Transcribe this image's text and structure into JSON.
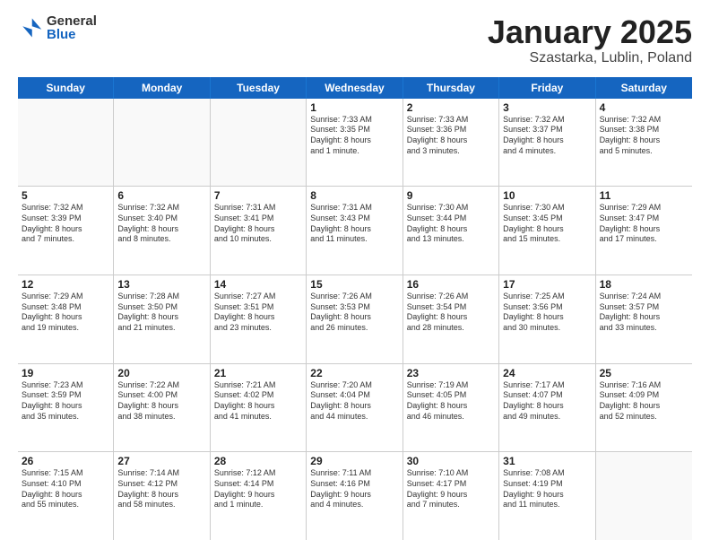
{
  "logo": {
    "general": "General",
    "blue": "Blue"
  },
  "header": {
    "month": "January 2025",
    "location": "Szastarka, Lublin, Poland"
  },
  "weekdays": [
    "Sunday",
    "Monday",
    "Tuesday",
    "Wednesday",
    "Thursday",
    "Friday",
    "Saturday"
  ],
  "rows": [
    [
      {
        "day": "",
        "text": "",
        "empty": true
      },
      {
        "day": "",
        "text": "",
        "empty": true
      },
      {
        "day": "",
        "text": "",
        "empty": true
      },
      {
        "day": "1",
        "text": "Sunrise: 7:33 AM\nSunset: 3:35 PM\nDaylight: 8 hours\nand 1 minute."
      },
      {
        "day": "2",
        "text": "Sunrise: 7:33 AM\nSunset: 3:36 PM\nDaylight: 8 hours\nand 3 minutes."
      },
      {
        "day": "3",
        "text": "Sunrise: 7:32 AM\nSunset: 3:37 PM\nDaylight: 8 hours\nand 4 minutes."
      },
      {
        "day": "4",
        "text": "Sunrise: 7:32 AM\nSunset: 3:38 PM\nDaylight: 8 hours\nand 5 minutes."
      }
    ],
    [
      {
        "day": "5",
        "text": "Sunrise: 7:32 AM\nSunset: 3:39 PM\nDaylight: 8 hours\nand 7 minutes."
      },
      {
        "day": "6",
        "text": "Sunrise: 7:32 AM\nSunset: 3:40 PM\nDaylight: 8 hours\nand 8 minutes."
      },
      {
        "day": "7",
        "text": "Sunrise: 7:31 AM\nSunset: 3:41 PM\nDaylight: 8 hours\nand 10 minutes."
      },
      {
        "day": "8",
        "text": "Sunrise: 7:31 AM\nSunset: 3:43 PM\nDaylight: 8 hours\nand 11 minutes."
      },
      {
        "day": "9",
        "text": "Sunrise: 7:30 AM\nSunset: 3:44 PM\nDaylight: 8 hours\nand 13 minutes."
      },
      {
        "day": "10",
        "text": "Sunrise: 7:30 AM\nSunset: 3:45 PM\nDaylight: 8 hours\nand 15 minutes."
      },
      {
        "day": "11",
        "text": "Sunrise: 7:29 AM\nSunset: 3:47 PM\nDaylight: 8 hours\nand 17 minutes."
      }
    ],
    [
      {
        "day": "12",
        "text": "Sunrise: 7:29 AM\nSunset: 3:48 PM\nDaylight: 8 hours\nand 19 minutes."
      },
      {
        "day": "13",
        "text": "Sunrise: 7:28 AM\nSunset: 3:50 PM\nDaylight: 8 hours\nand 21 minutes."
      },
      {
        "day": "14",
        "text": "Sunrise: 7:27 AM\nSunset: 3:51 PM\nDaylight: 8 hours\nand 23 minutes."
      },
      {
        "day": "15",
        "text": "Sunrise: 7:26 AM\nSunset: 3:53 PM\nDaylight: 8 hours\nand 26 minutes."
      },
      {
        "day": "16",
        "text": "Sunrise: 7:26 AM\nSunset: 3:54 PM\nDaylight: 8 hours\nand 28 minutes."
      },
      {
        "day": "17",
        "text": "Sunrise: 7:25 AM\nSunset: 3:56 PM\nDaylight: 8 hours\nand 30 minutes."
      },
      {
        "day": "18",
        "text": "Sunrise: 7:24 AM\nSunset: 3:57 PM\nDaylight: 8 hours\nand 33 minutes."
      }
    ],
    [
      {
        "day": "19",
        "text": "Sunrise: 7:23 AM\nSunset: 3:59 PM\nDaylight: 8 hours\nand 35 minutes."
      },
      {
        "day": "20",
        "text": "Sunrise: 7:22 AM\nSunset: 4:00 PM\nDaylight: 8 hours\nand 38 minutes."
      },
      {
        "day": "21",
        "text": "Sunrise: 7:21 AM\nSunset: 4:02 PM\nDaylight: 8 hours\nand 41 minutes."
      },
      {
        "day": "22",
        "text": "Sunrise: 7:20 AM\nSunset: 4:04 PM\nDaylight: 8 hours\nand 44 minutes."
      },
      {
        "day": "23",
        "text": "Sunrise: 7:19 AM\nSunset: 4:05 PM\nDaylight: 8 hours\nand 46 minutes."
      },
      {
        "day": "24",
        "text": "Sunrise: 7:17 AM\nSunset: 4:07 PM\nDaylight: 8 hours\nand 49 minutes."
      },
      {
        "day": "25",
        "text": "Sunrise: 7:16 AM\nSunset: 4:09 PM\nDaylight: 8 hours\nand 52 minutes."
      }
    ],
    [
      {
        "day": "26",
        "text": "Sunrise: 7:15 AM\nSunset: 4:10 PM\nDaylight: 8 hours\nand 55 minutes."
      },
      {
        "day": "27",
        "text": "Sunrise: 7:14 AM\nSunset: 4:12 PM\nDaylight: 8 hours\nand 58 minutes."
      },
      {
        "day": "28",
        "text": "Sunrise: 7:12 AM\nSunset: 4:14 PM\nDaylight: 9 hours\nand 1 minute."
      },
      {
        "day": "29",
        "text": "Sunrise: 7:11 AM\nSunset: 4:16 PM\nDaylight: 9 hours\nand 4 minutes."
      },
      {
        "day": "30",
        "text": "Sunrise: 7:10 AM\nSunset: 4:17 PM\nDaylight: 9 hours\nand 7 minutes."
      },
      {
        "day": "31",
        "text": "Sunrise: 7:08 AM\nSunset: 4:19 PM\nDaylight: 9 hours\nand 11 minutes."
      },
      {
        "day": "",
        "text": "",
        "empty": true
      }
    ]
  ]
}
